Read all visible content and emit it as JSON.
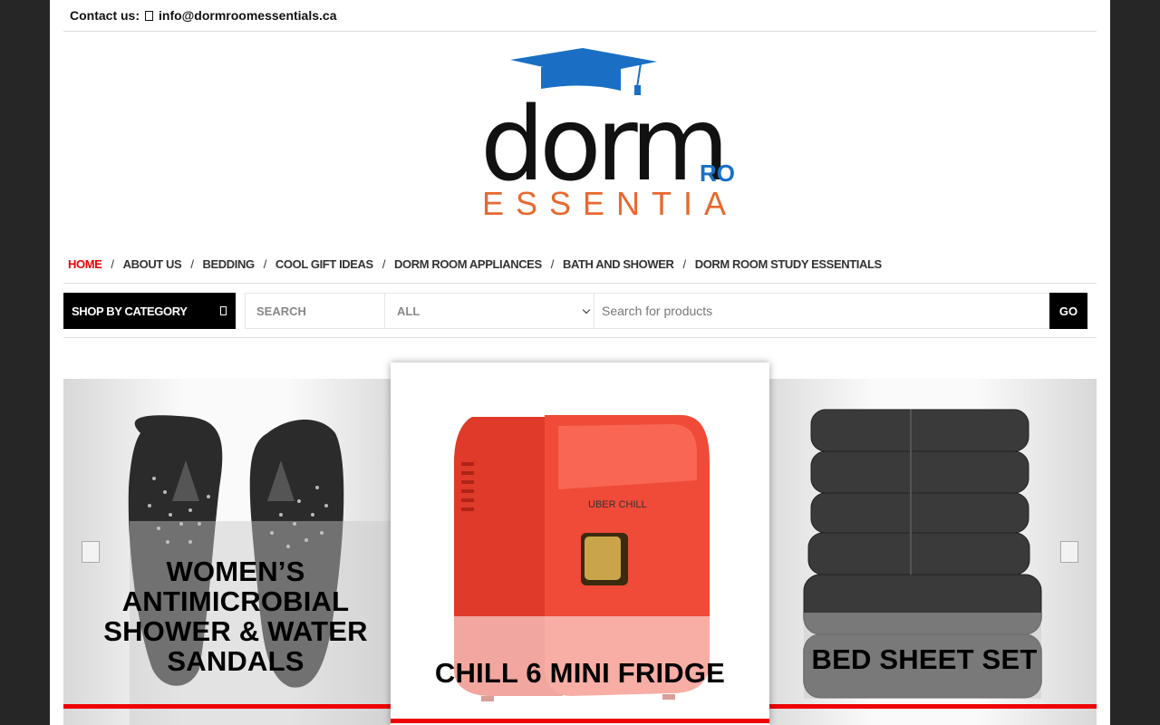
{
  "contact": {
    "label": "Contact us:",
    "email": "info@dormroomessentials.ca"
  },
  "logo": {
    "word": "dorm",
    "room": "ROOM",
    "essentials": "ESSENTIALS",
    "colors": {
      "cap": "#1a6fc4",
      "dorm": "#111111",
      "room": "#1a6fc4",
      "essentials": "#e8692e"
    }
  },
  "nav": {
    "items": [
      {
        "label": "HOME",
        "active": true
      },
      {
        "label": "ABOUT US"
      },
      {
        "label": "BEDDING"
      },
      {
        "label": "COOL GIFT IDEAS"
      },
      {
        "label": "DORM ROOM APPLIANCES"
      },
      {
        "label": "BATH AND SHOWER"
      },
      {
        "label": "DORM ROOM STUDY ESSENTIALS"
      }
    ],
    "separator": "/",
    "active_color": "#e00000"
  },
  "search": {
    "category_button": "SHOP BY CATEGORY",
    "label": "SEARCH",
    "select_value": "ALL",
    "placeholder": "Search for products",
    "go": "GO"
  },
  "carousel": {
    "slides": [
      {
        "title": "WOMEN’S ANTIMICROBIAL SHOWER & WATER SANDALS",
        "image": "black flip-flop sandals"
      },
      {
        "title": "CHILL 6 MINI FRIDGE",
        "image": "red mini fridge",
        "brand": "UBER CHILL"
      },
      {
        "title": "BED SHEET SET",
        "image": "folded grey sheets"
      }
    ],
    "accent_color": "#e00000"
  }
}
